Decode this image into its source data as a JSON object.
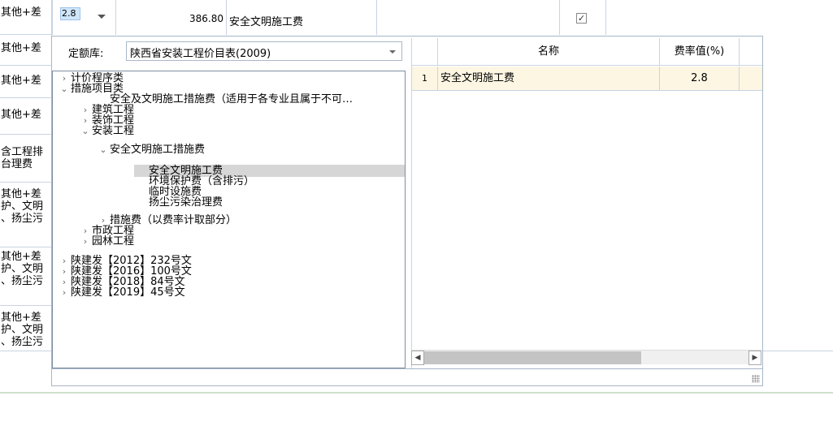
{
  "left_column": [
    {
      "text": "其他+差"
    },
    {
      "text": "其他+差"
    },
    {
      "text": "其他+差"
    },
    {
      "text": "其他+差"
    },
    {
      "text": "含工程排\n台理费"
    },
    {
      "text": "其他+差\n护、文明\n、扬尘污"
    },
    {
      "text": "其他+差\n护、文明\n、扬尘污"
    },
    {
      "text": "其他+差\n护、文明\n、扬尘污"
    }
  ],
  "top_row": {
    "rate_value": "2.8",
    "amount": "386.80",
    "name": "安全文明施工费",
    "checked": true
  },
  "popup": {
    "lib_label": "定额库:",
    "lib_value": "陕西省安装工程价目表(2009)",
    "tree": [
      {
        "label": "计价程序类",
        "toggle": ">"
      },
      {
        "label": "措施项目类",
        "toggle": "v"
      },
      {
        "label": "安全及文明施工措施费（适用于各专业且属于不可…",
        "toggle": ""
      },
      {
        "label": "建筑工程",
        "toggle": ">"
      },
      {
        "label": "装饰工程",
        "toggle": ">"
      },
      {
        "label": "安装工程",
        "toggle": "v"
      },
      {
        "label": "安全文明施工措施费",
        "toggle": "v"
      },
      {
        "label": "安全文明施工费",
        "toggle": "",
        "selected": true
      },
      {
        "label": "环境保护费（含排污）",
        "toggle": ""
      },
      {
        "label": "临时设施费",
        "toggle": ""
      },
      {
        "label": "扬尘污染治理费",
        "toggle": ""
      },
      {
        "label": "措施费（以费率计取部分）",
        "toggle": ">"
      },
      {
        "label": "市政工程",
        "toggle": ">"
      },
      {
        "label": "园林工程",
        "toggle": ">"
      },
      {
        "label": "陕建发【2012】232号文",
        "toggle": ">"
      },
      {
        "label": "陕建发【2016】100号文",
        "toggle": ">"
      },
      {
        "label": "陕建发【2018】84号文",
        "toggle": ">"
      },
      {
        "label": "陕建发【2019】45号文",
        "toggle": ">"
      }
    ],
    "table": {
      "headers": {
        "name": "名称",
        "rate": "费率值(%)"
      },
      "rows": [
        {
          "index": "1",
          "name": "安全文明施工费",
          "rate": "2.8"
        }
      ]
    }
  }
}
